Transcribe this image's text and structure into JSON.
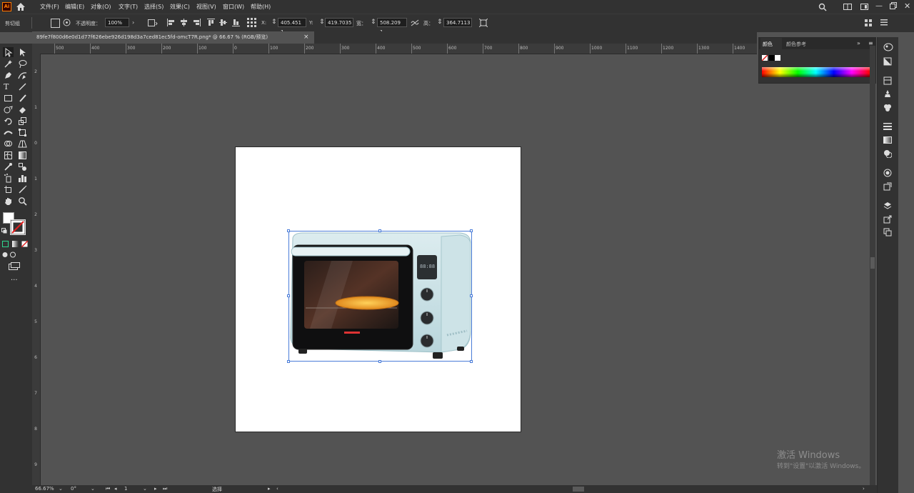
{
  "menubar": {
    "items": [
      "文件(F)",
      "编辑(E)",
      "对象(O)",
      "文字(T)",
      "选择(S)",
      "效果(C)",
      "视图(V)",
      "窗口(W)",
      "帮助(H)"
    ],
    "app_logo": "Ai"
  },
  "controlbar": {
    "left_label": "剪切组",
    "opacity_label": "不透明度：",
    "opacity_value": "100%",
    "x_label": "X:",
    "x_value": "405.451 1",
    "y_label": "Y:",
    "y_value": "419.7035",
    "w_label": "宽：",
    "w_value": "508.209 1",
    "h_label": "高：",
    "h_value": "364.7113"
  },
  "document": {
    "tab_title": "89fe7f800d6e0d1d77f626ebe926d198d3a7ced81ec5fd-omcT7R.png* @ 66.67 % (RGB/预览)",
    "close_symbol": "×"
  },
  "ruler": {
    "h_ticks": [
      "500",
      "400",
      "300",
      "200",
      "100",
      "0",
      "100",
      "200",
      "300",
      "400",
      "500",
      "600",
      "700",
      "800",
      "900",
      "1000",
      "1100",
      "1200",
      "1300",
      "1400"
    ],
    "v_ticks": [
      "2",
      "1",
      "0",
      "1",
      "2",
      "3",
      "4",
      "5",
      "6",
      "7",
      "8",
      "9"
    ]
  },
  "color_panel": {
    "tab_color": "颜色",
    "tab_guide": "颜色参考"
  },
  "statusbar": {
    "zoom": "66.67%",
    "rotation": "0°",
    "artboard": "1",
    "tool": "选择"
  },
  "watermark": {
    "line1": "激活 Windows",
    "line2": "转到\"设置\"以激活 Windows。"
  },
  "colors": {
    "ui_dark": "#323232",
    "canvas": "#535353",
    "selection": "#4a7cd8",
    "oven_body": "#cfe6ea"
  },
  "icons": {
    "home": "home-icon",
    "search": "search-icon"
  }
}
